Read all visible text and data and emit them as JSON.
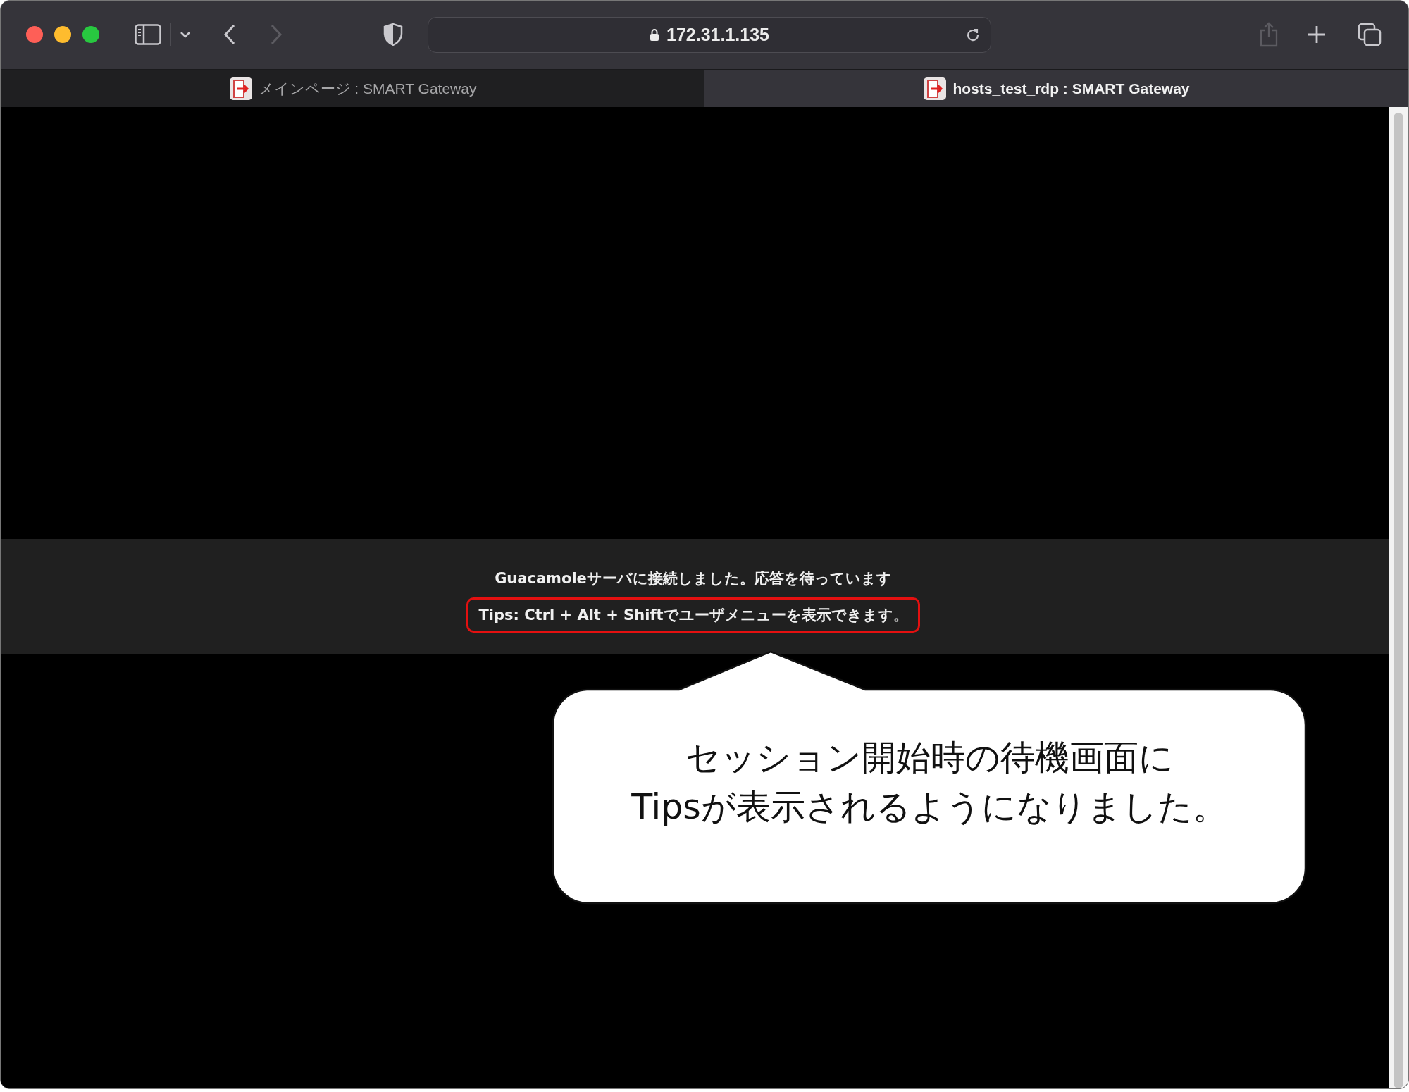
{
  "toolbar": {
    "url": "172.31.1.135",
    "back_disabled": false,
    "forward_disabled": true,
    "share_disabled": true
  },
  "tabs": [
    {
      "title": "メインページ : SMART Gateway",
      "selected": false
    },
    {
      "title": "hosts_test_rdp : SMART Gateway",
      "selected": true
    }
  ],
  "status_messages": [
    {
      "text": "Guacamoleサーバに接続しました。応答を待っています",
      "highlighted": false
    },
    {
      "text": "Tips: Ctrl + Alt + Shiftでユーザメニューを表示できます。",
      "highlighted": true
    }
  ],
  "callout": {
    "lines": [
      "セッション開始時の待機画面に",
      "Tipsが表示されるようになりました。"
    ]
  }
}
